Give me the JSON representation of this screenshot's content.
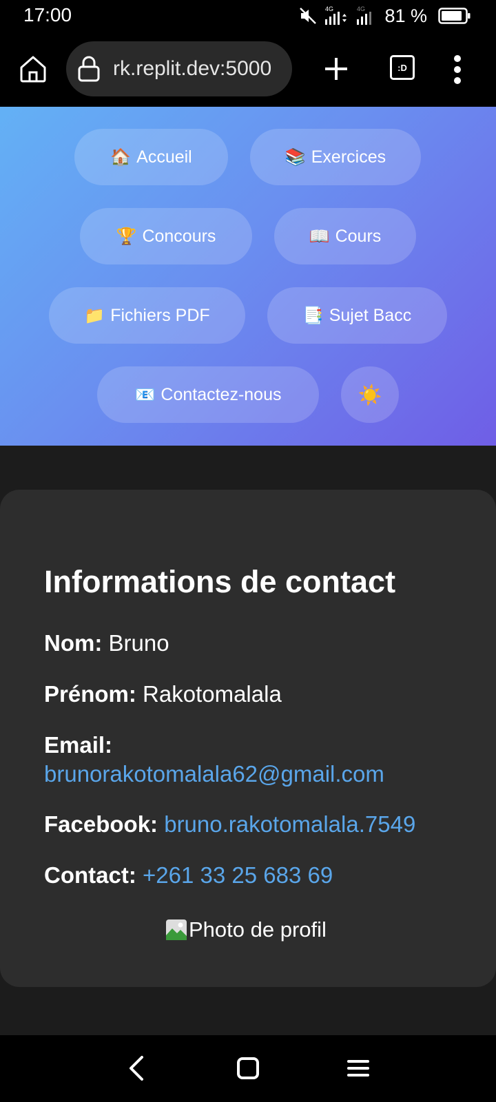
{
  "status_bar": {
    "time": "17:00",
    "battery": "81 %",
    "signal1_label": "4G",
    "signal2_label": "4G",
    "icons": [
      "mute-icon",
      "signal-icon",
      "signal-icon",
      "battery-icon"
    ]
  },
  "browser": {
    "url": "rk.replit.dev:5000",
    "tabs_label": ":D",
    "icons": [
      "home-icon",
      "lock-icon",
      "plus-icon",
      "tabs-icon",
      "more-vert-icon"
    ]
  },
  "nav": {
    "accueil": {
      "emoji": "🏠",
      "label": "Accueil"
    },
    "exercices": {
      "emoji": "📚",
      "label": "Exercices"
    },
    "concours": {
      "emoji": "🏆",
      "label": "Concours"
    },
    "cours": {
      "emoji": "📖",
      "label": "Cours"
    },
    "fichiers": {
      "emoji": "📁",
      "label": "Fichiers PDF"
    },
    "sujet": {
      "emoji": "📑",
      "label": "Sujet Bacc"
    },
    "contact": {
      "emoji": "📧",
      "label": "Contactez-nous"
    },
    "theme": {
      "emoji": "☀️"
    }
  },
  "contact_card": {
    "title": "Informations de contact",
    "nom_label": "Nom:",
    "nom_value": "Bruno",
    "prenom_label": "Prénom:",
    "prenom_value": "Rakotomalala",
    "email_label": "Email:",
    "email_value": "brunorakotomalala62@gmail.com",
    "facebook_label": "Facebook:",
    "facebook_value": "bruno.rakotomalala.7549",
    "contact_label": "Contact:",
    "contact_value": "+261 33 25 683 69",
    "photo_alt": "Photo de profil"
  },
  "colors": {
    "gradient_start": "#63b1f5",
    "gradient_end": "#6f5ee6",
    "link": "#5aa6ea",
    "card_bg": "#2d2d2d",
    "page_bg": "#1c1c1c"
  }
}
